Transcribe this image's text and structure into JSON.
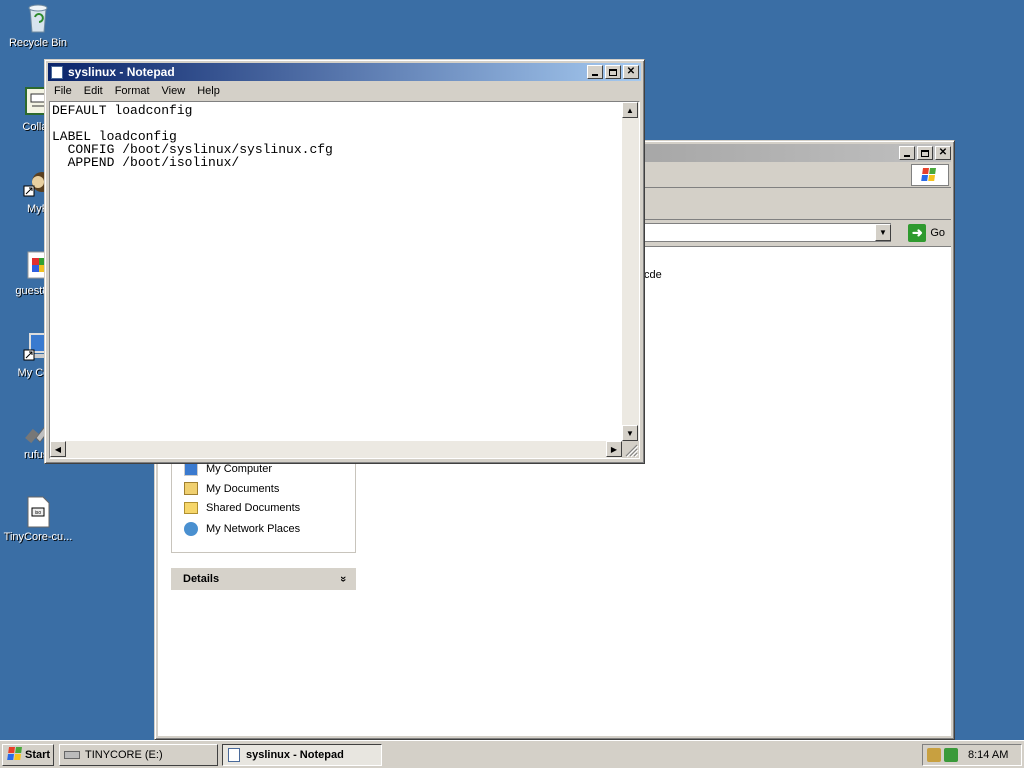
{
  "desktop": {
    "icons": [
      {
        "name": "recycle-bin",
        "label": "Recycle Bin"
      },
      {
        "name": "collab",
        "label": "Collab"
      },
      {
        "name": "myp",
        "label": "MyP"
      },
      {
        "name": "guest",
        "label": "guest82b"
      },
      {
        "name": "my-computer",
        "label": "My Com"
      },
      {
        "name": "rufus",
        "label": "rufus-"
      },
      {
        "name": "tinycore",
        "label": "TinyCore-cu..."
      }
    ]
  },
  "explorer": {
    "address_value": "",
    "go_label": "Go",
    "partial_file_label": "cde",
    "other_places": [
      "My Computer",
      "My Documents",
      "Shared Documents",
      "My Network Places"
    ],
    "details_label": "Details",
    "details_chevron": "»"
  },
  "notepad": {
    "title": "syslinux - Notepad",
    "menu": [
      "File",
      "Edit",
      "Format",
      "View",
      "Help"
    ],
    "content": "DEFAULT loadconfig\n\nLABEL loadconfig\n  CONFIG /boot/syslinux/syslinux.cfg\n  APPEND /boot/isolinux/"
  },
  "taskbar": {
    "start_label": "Start",
    "buttons": [
      "TINYCORE (E:)",
      "syslinux - Notepad"
    ],
    "clock": "8:14 AM"
  },
  "colors": {
    "desktop": "#3A6EA5",
    "active_title": "#0A246A",
    "inactive_title": "#808080"
  }
}
